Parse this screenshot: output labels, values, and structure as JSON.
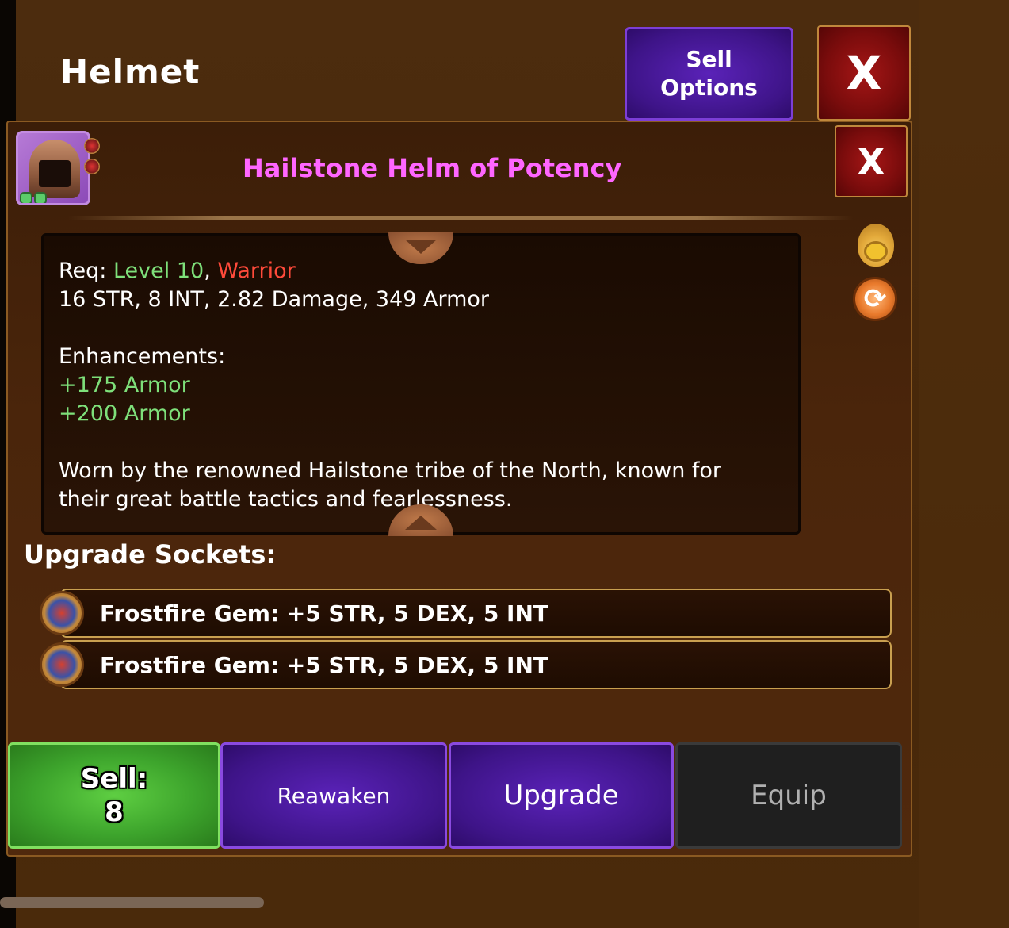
{
  "header": {
    "title": "Helmet",
    "sell_options_label": "Sell\nOptions",
    "close_label": "X"
  },
  "item": {
    "name": "Hailstone Helm of Potency",
    "close_label": "X",
    "name_color": "#ff66ff"
  },
  "details": {
    "req_prefix": "Req: ",
    "req_level": "Level 10",
    "req_separator": ", ",
    "req_class": "Warrior",
    "stats": "16 STR, 8 INT, 2.82 Damage, 349 Armor",
    "enhancements_title": "Enhancements:",
    "enhancements": [
      "+175 Armor",
      "+200 Armor"
    ],
    "flavor_line1": "Worn by the renowned Hailstone tribe of the North, known for",
    "flavor_line2": "their great battle tactics and fearlessness."
  },
  "sockets": {
    "title": "Upgrade Sockets:",
    "items": [
      {
        "text": "Frostfire Gem: +5 STR, 5 DEX, 5 INT"
      },
      {
        "text": "Frostfire Gem: +5 STR, 5 DEX, 5 INT"
      }
    ]
  },
  "actions": {
    "sell_label": "Sell:\n8",
    "reawaken_label": "Reawaken",
    "upgrade_label": "Upgrade",
    "equip_label": "Equip"
  },
  "colors": {
    "level_green": "#7ee07a",
    "class_red": "#ff4a3a",
    "purple_button": "#3e1488",
    "green_button": "#3da42c",
    "panel_brown": "#4a250b"
  },
  "icons": [
    "item-helm-icon",
    "money-bag-icon",
    "swap-icon",
    "gem-socket-icon"
  ]
}
